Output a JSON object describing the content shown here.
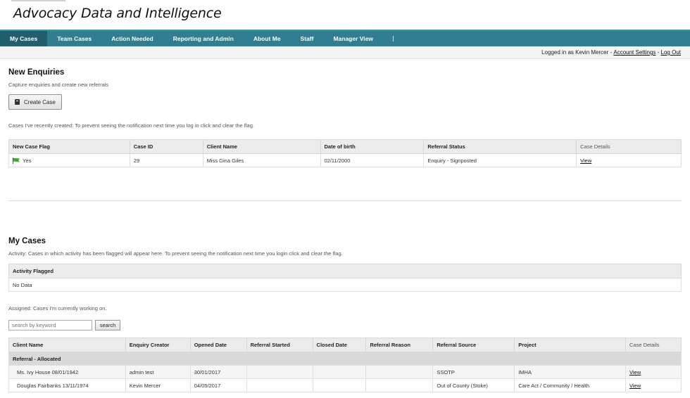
{
  "app_title": "Advocacy Data and Intelligence",
  "nav": [
    "My Cases",
    "Team Cases",
    "Action Needed",
    "Reporting and Admin",
    "About Me",
    "Staff",
    "Manager View"
  ],
  "userbar": {
    "logged_in_text": "Logged in as Kevin Mercer - ",
    "account_settings": "Account Settings",
    "sep": " - ",
    "logout": "Log Out"
  },
  "new_enquiries": {
    "title": "New Enquiries",
    "subtitle": "Capture enquiries and create new referrals",
    "create_button": "Create Case",
    "recent_note": "Cases I've recently created: To prevent seeing the notification next time you log in click and clear the flag.",
    "columns": [
      "New Case Flag",
      "Case ID",
      "Client Name",
      "Date of birth",
      "Referral Status",
      "Case Details"
    ],
    "rows": [
      {
        "flag": "Yes",
        "case_id": "29",
        "client_name": "Miss Gina Giles",
        "dob": "02/11/2000",
        "status": "Enquiry - Signposted",
        "details": "View"
      }
    ]
  },
  "my_cases": {
    "title": "My Cases",
    "activity_note": "Activity: Cases in which activity has been flagged will appear here. To prevent seeing the notification next time you login click and clear the flag.",
    "activity_header": "Activity Flagged",
    "activity_empty": "No Data",
    "assigned_note": "Assigned: Cases I'm currently working on.",
    "search_placeholder": "search by keyword",
    "search_button": "search",
    "columns": [
      "Client Name",
      "Enquiry Creator",
      "Opened Date",
      "Referral Started",
      "Closed Date",
      "Referral Reason",
      "Referral Source",
      "Project",
      "Case Details"
    ],
    "group_label": "Referral - Allocated",
    "rows": [
      {
        "client": "Ms. Ivy House 08/01/1942",
        "creator": "admin test",
        "opened": "30/01/2017",
        "started": "",
        "closed": "",
        "reason": "",
        "source": "SSOTP",
        "project": "IMHA",
        "details": "View"
      },
      {
        "client": "Douglas Fairbanks 13/11/1974",
        "creator": "Kevin Mercer",
        "opened": "04/05/2017",
        "started": "",
        "closed": "",
        "reason": "",
        "source": "Out of County (Stoke)",
        "project": "Care Act / Community / Health",
        "details": "View"
      }
    ]
  }
}
